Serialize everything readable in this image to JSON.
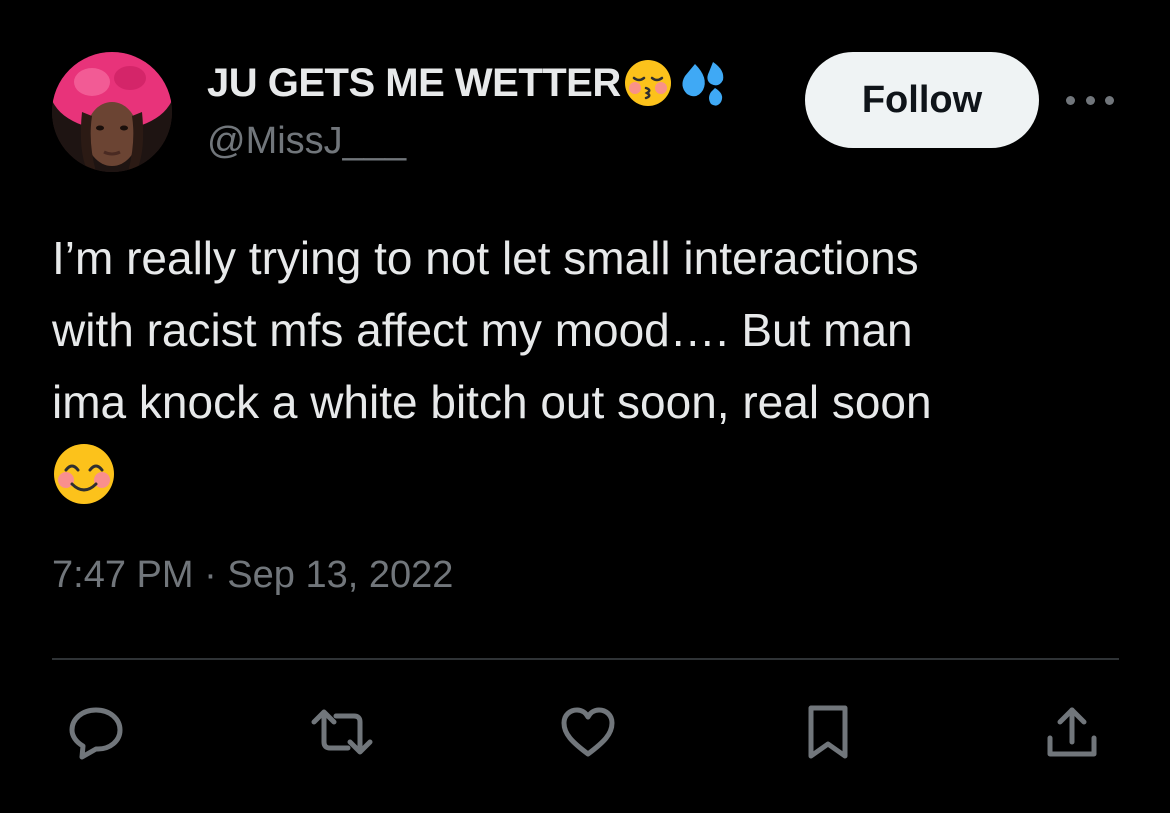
{
  "author": {
    "display_name": "JU GETS ME WETTER",
    "handle": "@MissJ___",
    "name_emojis": [
      "kissing-face-with-closed-eyes-icon",
      "sweat-droplets-icon"
    ]
  },
  "follow_button": {
    "label": "Follow"
  },
  "more_button": {
    "icon": "more-horizontal-icon"
  },
  "tweet": {
    "text": "I’m really trying to not let small interactions\nwith racist mfs affect my mood…. But man\nima knock a white bitch out soon, real soon",
    "trailing_emoji": "smiling-face-with-smiling-eyes-icon",
    "timestamp": "7:47 PM · Sep 13, 2022"
  },
  "actions": [
    {
      "name": "reply",
      "icon": "reply-icon"
    },
    {
      "name": "retweet",
      "icon": "retweet-icon"
    },
    {
      "name": "like",
      "icon": "heart-icon"
    },
    {
      "name": "bookmark",
      "icon": "bookmark-icon"
    },
    {
      "name": "share",
      "icon": "share-icon"
    }
  ],
  "colors": {
    "background": "#000000",
    "primary_text": "#e7e9ea",
    "secondary_text": "#71767b",
    "divider": "#2f3336",
    "follow_button_bg": "#eff3f4",
    "follow_button_text": "#0f1419"
  }
}
